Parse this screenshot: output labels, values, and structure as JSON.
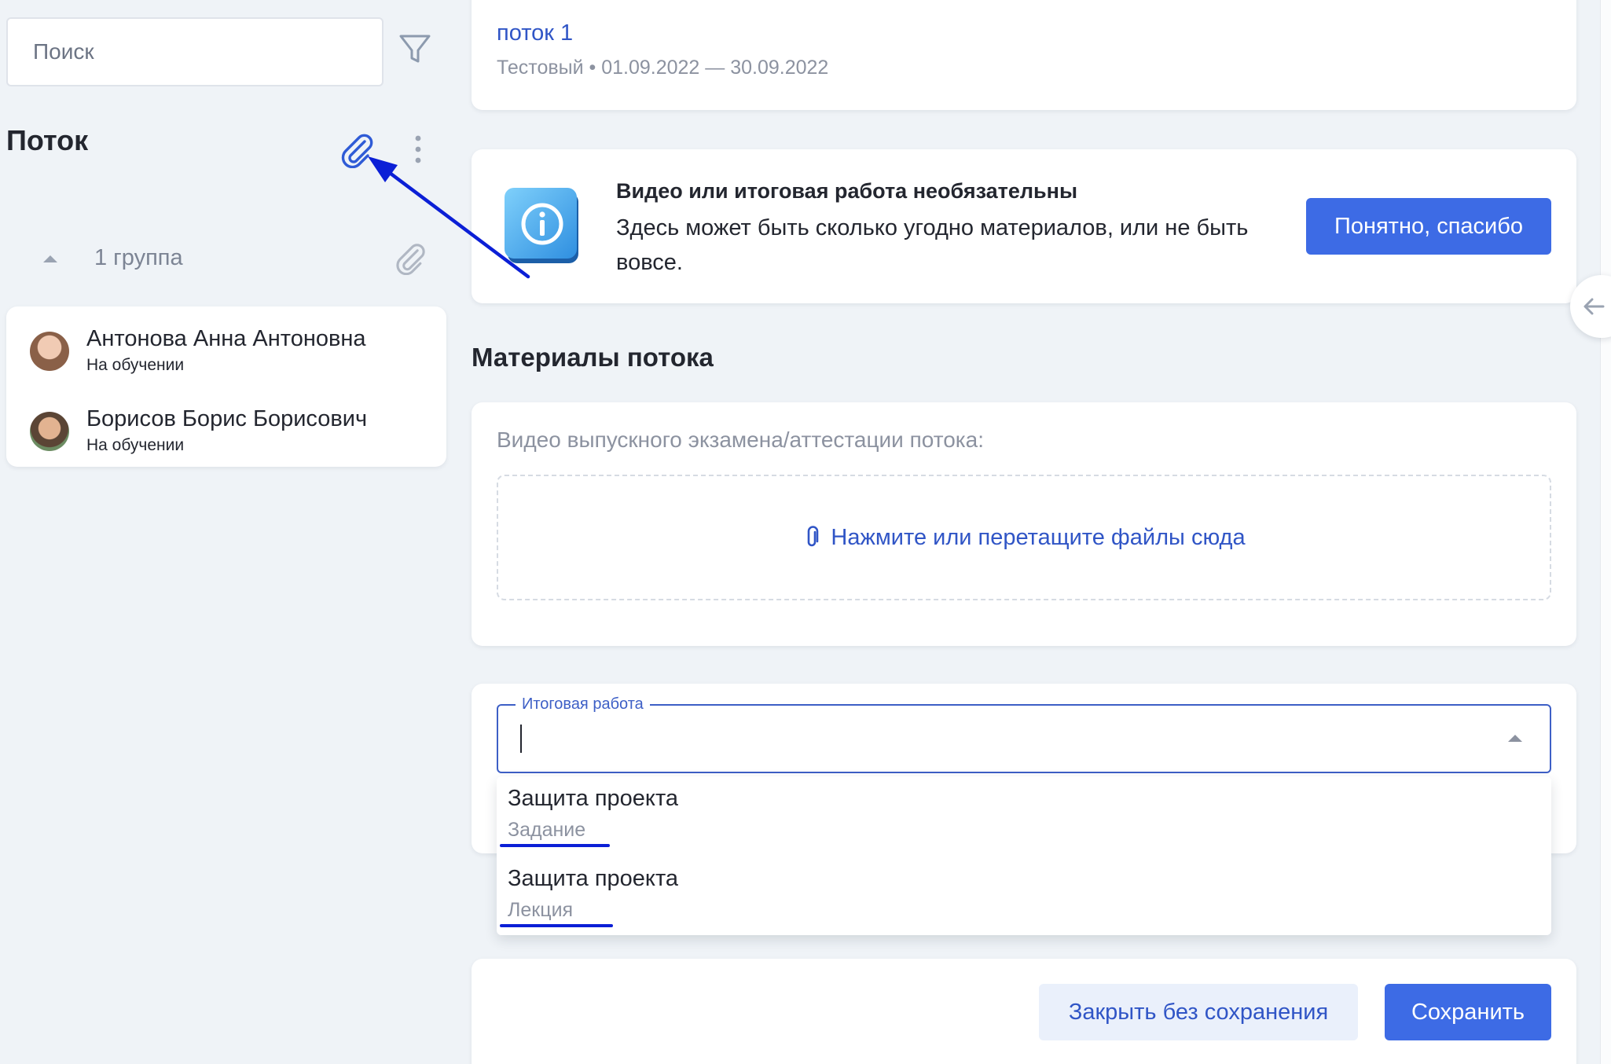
{
  "sidebar": {
    "search_placeholder": "Поиск",
    "title": "Поток",
    "group_label": "1 группа",
    "students": [
      {
        "name": "Антонова Анна Антоновна",
        "status": "На обучении"
      },
      {
        "name": "Борисов Борис Борисович",
        "status": "На обучении"
      }
    ]
  },
  "header": {
    "stream_name": "поток 1",
    "stream_meta": "Тестовый • 01.09.2022 — 30.09.2022"
  },
  "info": {
    "title": "Видео или итоговая работа необязательны",
    "text": "Здесь может быть сколько угодно материалов, или не быть вовсе.",
    "button": "Понятно, спасибо"
  },
  "materials": {
    "section_title": "Материалы потока",
    "video_label": "Видео выпускного экзамена/аттестации потока:",
    "dropzone_text": "Нажмите или перетащите файлы сюда"
  },
  "final_work": {
    "label": "Итоговая работа",
    "value": "",
    "options": [
      {
        "title": "Защита проекта",
        "type": "Задание"
      },
      {
        "title": "Защита проекта",
        "type": "Лекция"
      }
    ]
  },
  "footer": {
    "close_button": "Закрыть без сохранения",
    "save_button": "Сохранить"
  },
  "colors": {
    "accent": "#3d6be5",
    "link": "#3055c6",
    "annotation": "#0b1fd6",
    "background": "#eff3f7"
  },
  "icons": [
    "filter-icon",
    "paperclip-icon",
    "more-vertical-icon",
    "chevron-up-icon",
    "info-icon",
    "arrow-left-icon"
  ]
}
